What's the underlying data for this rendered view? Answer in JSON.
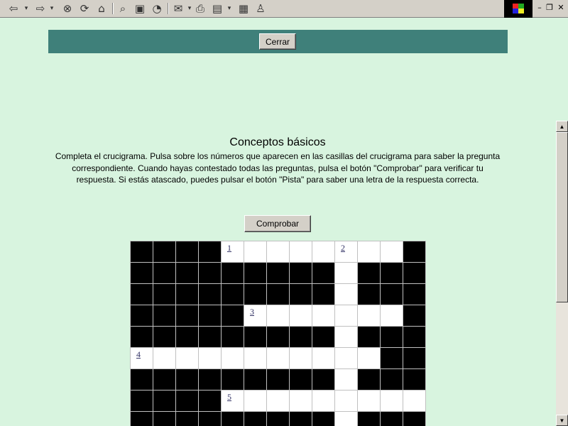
{
  "toolbar": {
    "icons": [
      "back-icon",
      "forward-icon",
      "stop-icon",
      "refresh-icon",
      "home-icon",
      "search-icon",
      "favorites-icon",
      "history-icon",
      "mail-icon",
      "print-icon",
      "edit-icon",
      "discuss-icon",
      "messenger-icon"
    ]
  },
  "header": {
    "close_label": "Cerrar"
  },
  "content": {
    "title": "Conceptos básicos",
    "instructions": "Completa el crucigrama. Pulsa sobre los números que aparecen en las casillas del crucigrama para saber la pregunta correspondiente. Cuando hayas contestado todas las preguntas, pulsa el botón \"Comprobar\" para verificar tu respuesta. Si estás atascado, puedes pulsar el botón \"Pista\" para saber una letra de la respuesta correcta.",
    "check_label": "Comprobar"
  },
  "crossword": {
    "rows": [
      "BBBBWWWWWWWWB",
      "BBBBBBBBBWBBB",
      "BBBBBBBBBWBBB",
      "BBBBBWWWWWWWB",
      "BBBBBBBBBWBBB",
      "WWWWWWWWWWWBB",
      "BBBBBBBBBWBBB",
      "BBBBWWWWWWWWW",
      "BBBBBBBBBWBBB"
    ],
    "numbers": [
      {
        "row": 0,
        "col": 4,
        "n": "1"
      },
      {
        "row": 0,
        "col": 9,
        "n": "2"
      },
      {
        "row": 3,
        "col": 5,
        "n": "3"
      },
      {
        "row": 5,
        "col": 0,
        "n": "4"
      },
      {
        "row": 7,
        "col": 4,
        "n": "5"
      }
    ]
  }
}
